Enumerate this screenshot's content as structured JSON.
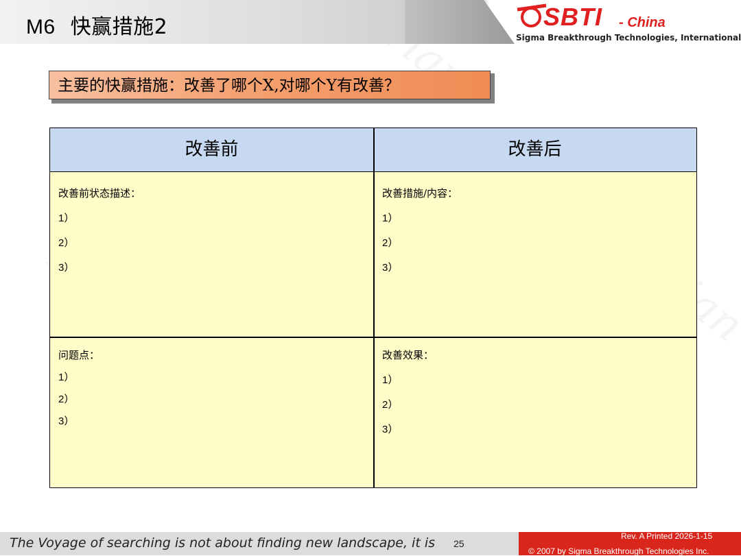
{
  "header": {
    "code": "M6",
    "title": "快赢措施2"
  },
  "logo": {
    "brand": "SBTI",
    "region": "- China",
    "subtitle": "Sigma Breakthrough Technologies, International"
  },
  "callout": {
    "text": "主要的快赢措施：改善了哪个X,对哪个Y有改善？"
  },
  "table": {
    "headers": [
      "改善前",
      "改善后"
    ],
    "cells": [
      {
        "label": "改善前状态描述：",
        "items": [
          "1）",
          "2）",
          "3）"
        ]
      },
      {
        "label": "改善措施/内容：",
        "items": [
          "1）",
          "2）",
          "3）"
        ]
      },
      {
        "label": "问题点：",
        "items": [
          "1）",
          "2）",
          "3）"
        ]
      },
      {
        "label": "改善效果：",
        "items": [
          "1）",
          "2）",
          "3）"
        ]
      }
    ]
  },
  "footer": {
    "quote": "The Voyage of searching is not about finding new landscape, it is",
    "page": "25",
    "revision": "Rev. A   Printed 2026-1-15",
    "copyright": "© 2007 by Sigma Breakthrough Technologies Inc."
  },
  "colors": {
    "callout_start": "#f8c0a0",
    "callout_end": "#f08c55",
    "header_cell": "#c6d9f1",
    "body_cell": "#fffcc8",
    "brand_red": "#e02020",
    "footer_red": "#d9261c"
  }
}
